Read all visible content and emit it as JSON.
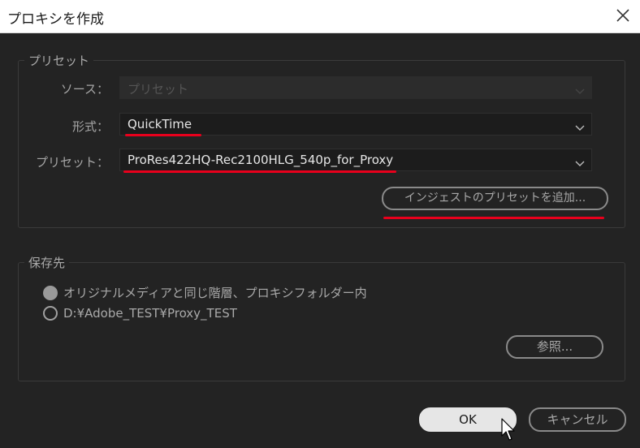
{
  "window": {
    "title": "プロキシを作成"
  },
  "preset_group": {
    "legend": "プリセット",
    "source_label": "ソース：",
    "source_value": "プリセット",
    "format_label": "形式：",
    "format_value": "QuickTime",
    "preset_label": "プリセット：",
    "preset_value": "ProRes422HQ-Rec2100HLG_540p_for_Proxy",
    "add_ingest_button": "インジェストのプリセットを追加..."
  },
  "destination_group": {
    "legend": "保存先",
    "option_same": "オリジナルメディアと同じ階層、プロキシフォルダー内",
    "option_path": "D:¥Adobe_TEST¥Proxy_TEST",
    "browse_button": "参照..."
  },
  "footer": {
    "ok_button": "OK",
    "cancel_button": "キャンセル"
  },
  "colors": {
    "annotation": "#e8001c",
    "background": "#232323"
  },
  "icons": [
    "close-icon",
    "chevron-down-icon",
    "mouse-cursor-icon"
  ]
}
